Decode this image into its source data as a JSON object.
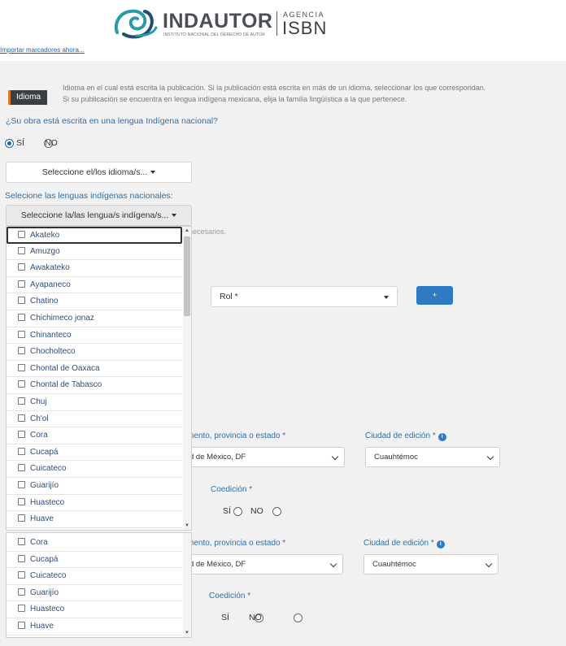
{
  "header": {
    "brand": "INDAUTOR",
    "brand_subtitle": "INSTITUTO NACIONAL DEL DERECHO DE AUTOR",
    "agency": "AGENCIA",
    "isbn": "ISBN",
    "bookmark_link": "Importar marcadores ahora..."
  },
  "idioma": {
    "badge": "Idioma",
    "help_line_1": "Idioma en el cual está escrita la publicación. Si la publicación está escrita en más de un idioma, seleccionar los que correspondan.",
    "help_line_2": "Si su publicación se encuentra en lengua indígena mexicana, elija la familia lingüística a la que pertenece.",
    "question": "¿Su obra está escrita en una lengua Indígena nacional?",
    "option_yes": "SÍ",
    "option_no": "NO",
    "selected": "SÍ",
    "idioma_select": "Seleccione el/los idioma/s...",
    "indigenous_label": "Selecione las lenguas indígenas nacionales:",
    "indigenous_select": "Seleccione la/las lengua/s indígena/s..."
  },
  "dropdown": {
    "items": [
      "Akateko",
      "Amuzgo",
      "Awakateko",
      "Ayapaneco",
      "Chatino",
      "Chichimeco jonaz",
      "Chinanteco",
      "Chocholteco",
      "Chontal de Oaxaca",
      "Chontal de Tabasco",
      "Chuj",
      "Ch'ol",
      "Cora",
      "Cucapá",
      "Cuicateco",
      "Guarijío",
      "Huasteco",
      "Huave"
    ],
    "focused_item": "Akateko",
    "overflow_items": [
      "Cora",
      "Cucapá",
      "Cuicateco",
      "Guarijío",
      "Huasteco",
      "Huave"
    ]
  },
  "form": {
    "necesarios_text": "necesarios.",
    "rol_placeholder": "Rol *",
    "add_button": "+",
    "section1": {
      "region_label": "mento, provincia o estado *",
      "region_value": "d de México, DF",
      "city_label": "Ciudad de edición *",
      "city_value": "Cuauhtémoc",
      "coedition_label": "Coedición *",
      "option_yes": "SÍ",
      "option_no": "NO"
    },
    "section2": {
      "region_label": "mento, provincia o estado *",
      "region_value": "d de México, DF",
      "city_label": "Ciudad de edición *",
      "city_value": "Cuauhtémoc",
      "coedition_label": "Coedición *",
      "option_yes": "SÍ",
      "option_no": "NO"
    }
  },
  "colors": {
    "accent_blue": "#2e7bc4",
    "label_blue": "#2f6fa8",
    "badge_dark": "#3a3f44",
    "logo_teal": "#2a9aa8"
  }
}
